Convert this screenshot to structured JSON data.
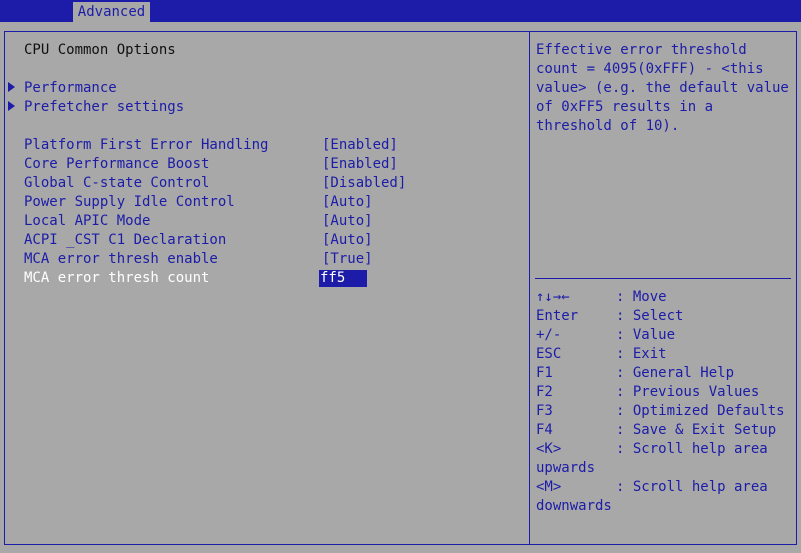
{
  "tabs": {
    "active": "Advanced"
  },
  "menu": {
    "title": "CPU Common Options",
    "submenus": [
      {
        "label": "Performance"
      },
      {
        "label": "Prefetcher settings"
      }
    ],
    "options": [
      {
        "label": "Platform First Error Handling",
        "value": "[Enabled]"
      },
      {
        "label": "Core Performance Boost",
        "value": "[Enabled]"
      },
      {
        "label": "Global C-state Control",
        "value": "[Disabled]"
      },
      {
        "label": "Power Supply Idle Control",
        "value": "[Auto]"
      },
      {
        "label": "Local APIC Mode",
        "value": "[Auto]"
      },
      {
        "label": "ACPI _CST C1 Declaration",
        "value": "[Auto]"
      },
      {
        "label": "MCA error thresh enable",
        "value": "[True]"
      },
      {
        "label": "MCA error thresh count",
        "value": "ff5"
      }
    ]
  },
  "help": {
    "lines": [
      "Effective error threshold",
      "count = 4095(0xFFF) - <this",
      "value> (e.g. the default value",
      "of 0xFF5 results in a",
      "threshold of 10)."
    ]
  },
  "keys": [
    {
      "key": "↑↓→←",
      "desc": ": Move"
    },
    {
      "key": "Enter",
      "desc": ": Select"
    },
    {
      "key": "+/-",
      "desc": ": Value"
    },
    {
      "key": "ESC",
      "desc": ": Exit"
    },
    {
      "key": "F1",
      "desc": ": General Help"
    },
    {
      "key": "F2",
      "desc": ": Previous Values"
    },
    {
      "key": "F3",
      "desc": ": Optimized Defaults"
    },
    {
      "key": "F4",
      "desc": ": Save & Exit Setup"
    },
    {
      "key": "<K>",
      "desc": ": Scroll help area",
      "cont": "upwards"
    },
    {
      "key": "<M>",
      "desc": ": Scroll help area",
      "cont": "downwards"
    }
  ],
  "colors": {
    "background": "#a8a8a8",
    "accent": "#1c1ca8",
    "highlight_text": "#ffffff"
  }
}
